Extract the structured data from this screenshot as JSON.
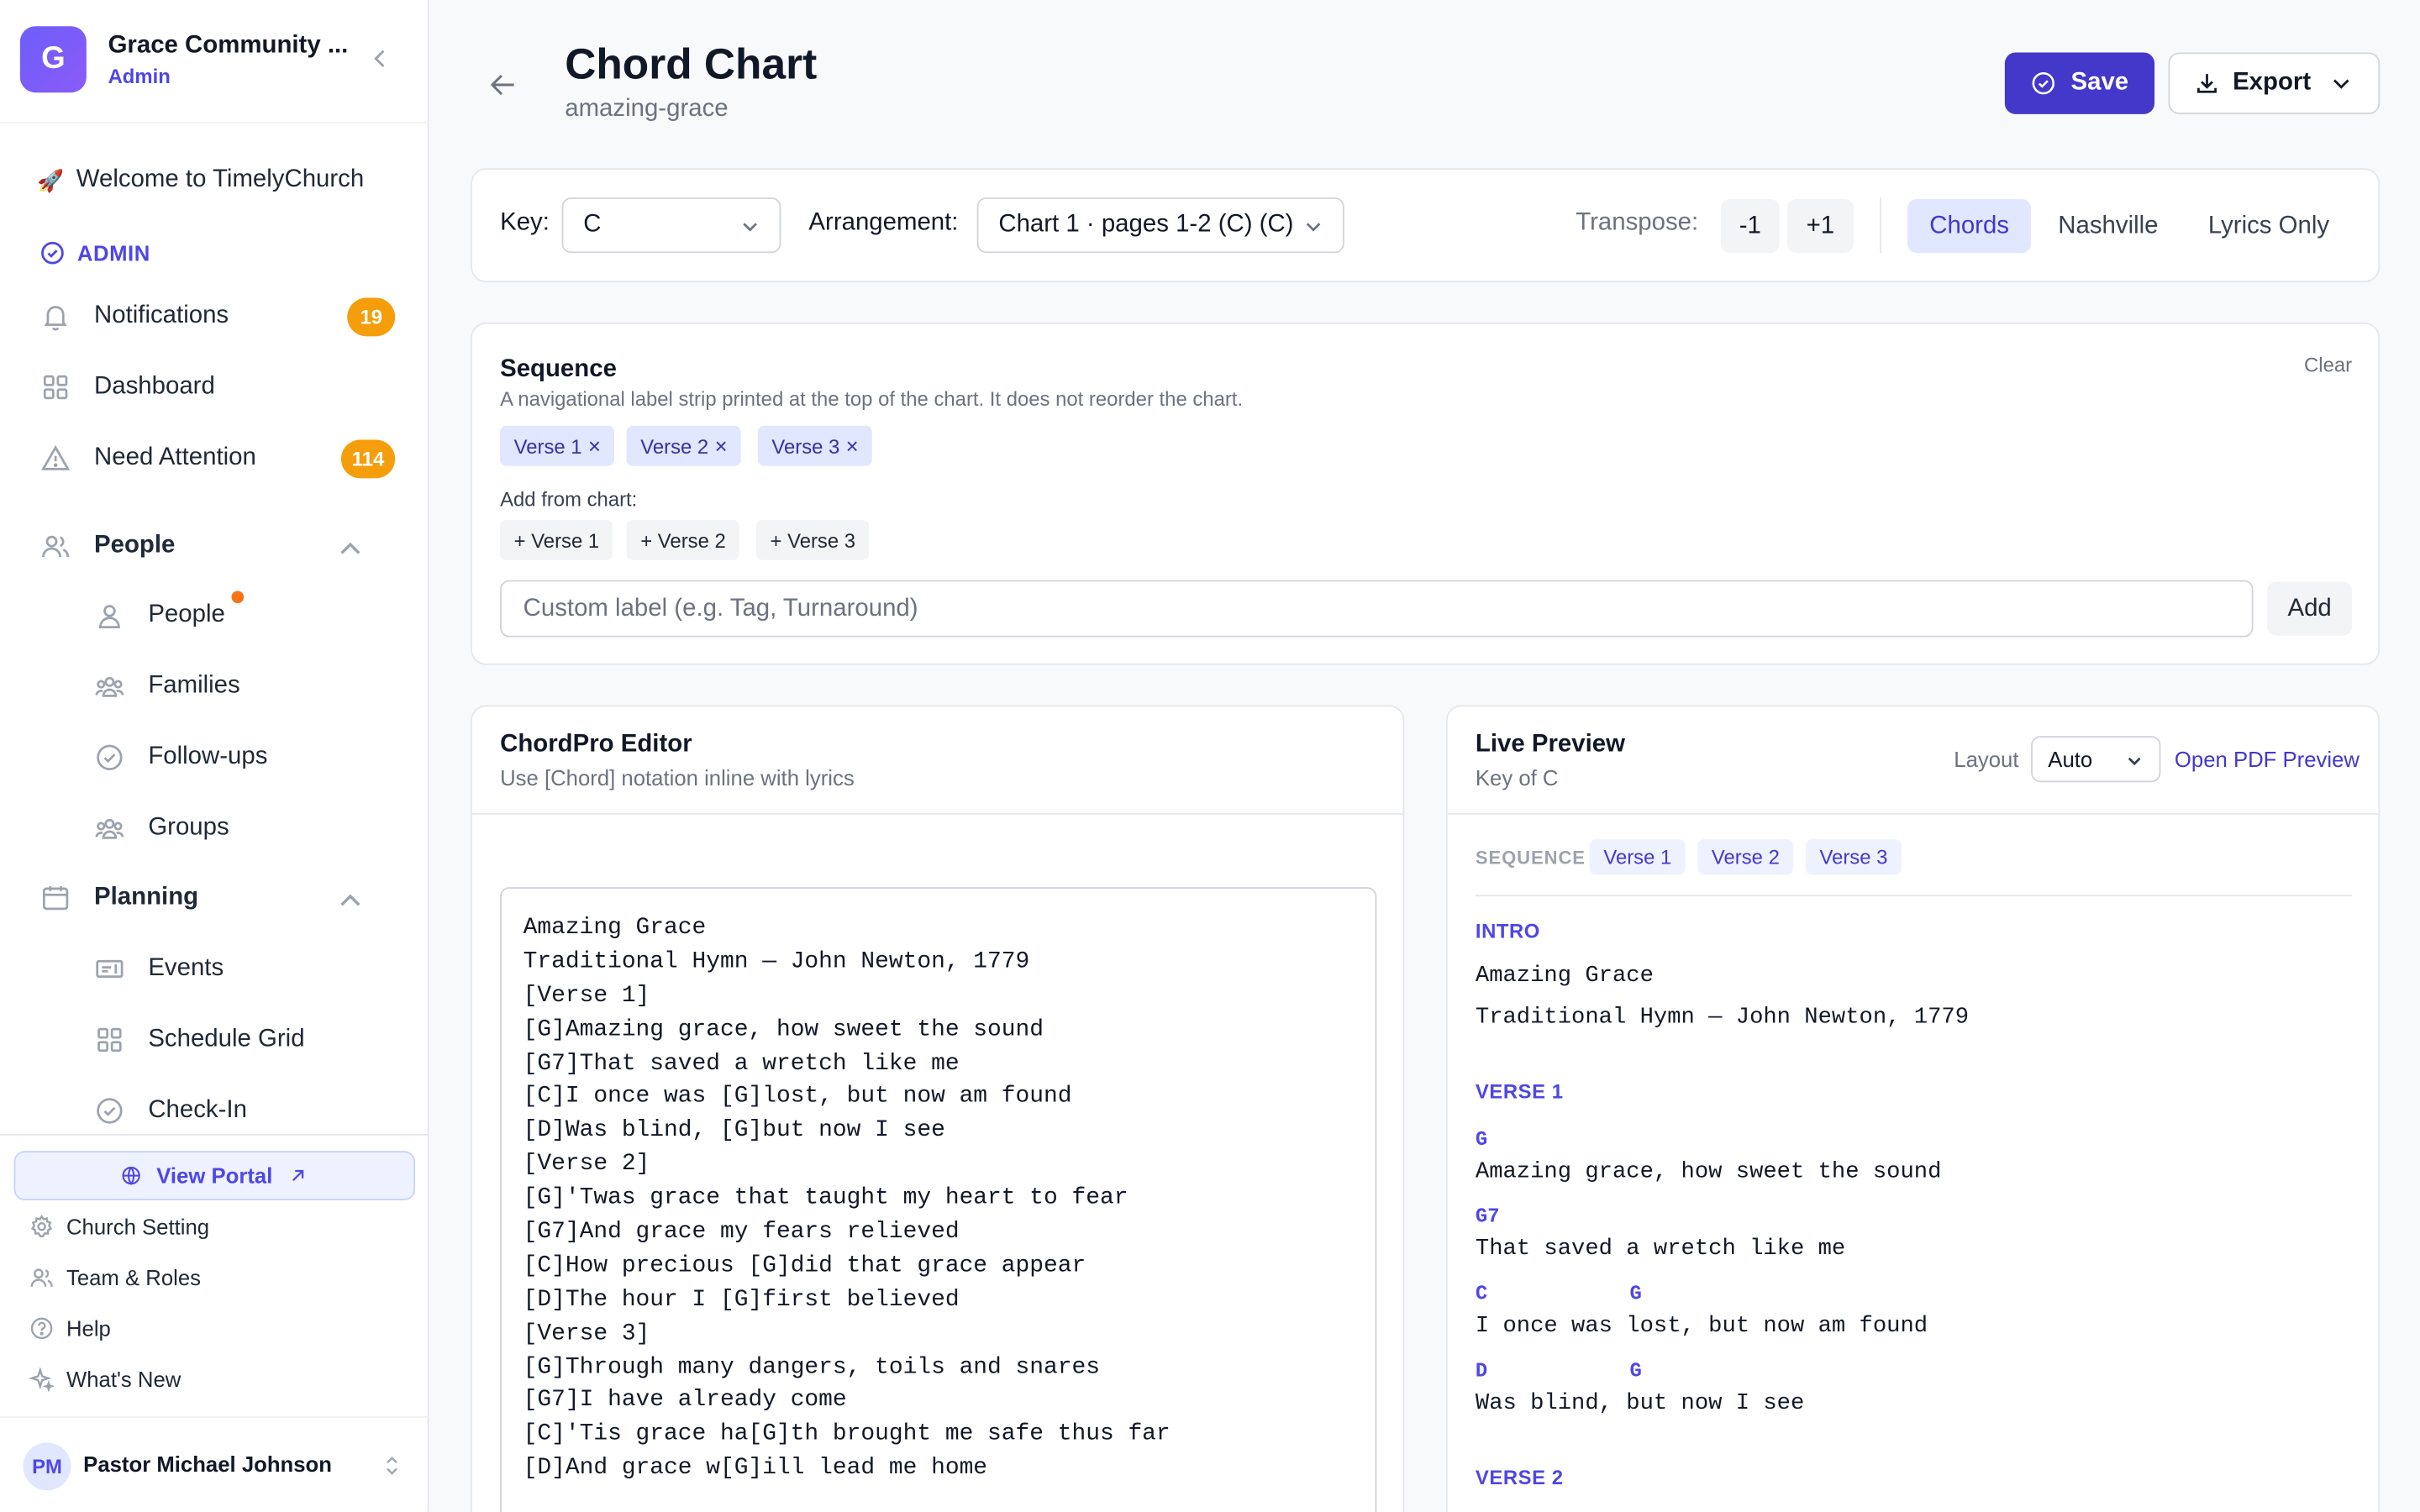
{
  "org": {
    "initial": "G",
    "name": "Grace Community ...",
    "role": "Admin"
  },
  "sidebar": {
    "welcome": "Welcome to TimelyChurch",
    "admin_label": "ADMIN",
    "notifications": {
      "label": "Notifications",
      "count": "19"
    },
    "dashboard": "Dashboard",
    "need_attention": {
      "label": "Need Attention",
      "count": "114"
    },
    "people_group": "People",
    "people_items": [
      "People",
      "Families",
      "Follow-ups",
      "Groups"
    ],
    "planning_group": "Planning",
    "planning_items": [
      "Events",
      "Schedule Grid",
      "Check-In"
    ],
    "view_portal": "View Portal",
    "footer_items": [
      "Church Setting",
      "Team & Roles",
      "Help",
      "What's New"
    ],
    "user": {
      "initials": "PM",
      "name": "Pastor Michael Johnson"
    }
  },
  "header": {
    "title": "Chord Chart",
    "slug": "amazing-grace",
    "save_label": "Save",
    "export_label": "Export"
  },
  "toolbar": {
    "key_label": "Key:",
    "key_value": "C",
    "arrangement_label": "Arrangement:",
    "arrangement_value": "Chart 1 · pages 1-2 (C) (C)",
    "transpose_label": "Transpose:",
    "transpose_down": "-1",
    "transpose_up": "+1",
    "modes": [
      "Chords",
      "Nashville",
      "Lyrics Only"
    ],
    "active_mode": "Chords"
  },
  "sequence": {
    "title": "Sequence",
    "description": "A navigational label strip printed at the top of the chart. It does not reorder the chart.",
    "clear_label": "Clear",
    "chips": [
      "Verse 1",
      "Verse 2",
      "Verse 3"
    ],
    "remove_glyph": "×",
    "add_from_label": "Add from chart:",
    "add_chips": [
      "+ Verse 1",
      "+ Verse 2",
      "+ Verse 3"
    ],
    "custom_placeholder": "Custom label (e.g. Tag, Turnaround)",
    "add_label": "Add"
  },
  "editor": {
    "title": "ChordPro Editor",
    "subtitle": "Use [Chord] notation inline with lyrics",
    "lines": [
      "Amazing Grace",
      "Traditional Hymn — John Newton, 1779",
      "[Verse 1]",
      "[G]Amazing grace, how sweet the sound",
      "[G7]That saved a wretch like me",
      "[C]I once was [G]lost, but now am found",
      "[D]Was blind, [G]but now I see",
      "[Verse 2]",
      "[G]'Twas grace that taught my heart to fear",
      "[G7]And grace my fears relieved",
      "[C]How precious [G]did that grace appear",
      "[D]The hour I [G]first believed",
      "[Verse 3]",
      "[G]Through many dangers, toils and snares",
      "[G7]I have already come",
      "[C]'Tis grace ha[G]th brought me safe thus far",
      "[D]And grace w[G]ill lead me home"
    ]
  },
  "preview": {
    "title": "Live Preview",
    "subtitle": "Key of C",
    "layout_label": "Layout",
    "layout_value": "Auto",
    "pdf_link": "Open PDF Preview",
    "sequence_label": "SEQUENCE",
    "sequence_chips": [
      "Verse 1",
      "Verse 2",
      "Verse 3"
    ],
    "intro_head": "INTRO",
    "intro_lines": [
      "Amazing Grace",
      "Traditional Hymn — John Newton, 1779"
    ],
    "verse1_head": "VERSE 1",
    "verse1": [
      {
        "chords": [
          "G"
        ],
        "lyric": "Amazing grace, how sweet the sound"
      },
      {
        "chords": [
          "G7"
        ],
        "lyric": "That saved a wretch like me"
      },
      {
        "chords": [
          "C",
          "G"
        ],
        "lyric": "I once was lost, but now am found"
      },
      {
        "chords": [
          "D",
          "G"
        ],
        "lyric": "Was blind, but now I see"
      }
    ],
    "verse2_head": "VERSE 2"
  }
}
